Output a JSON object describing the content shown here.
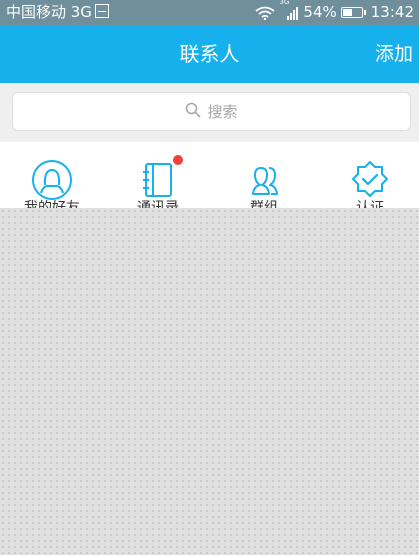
{
  "status_bar": {
    "carrier": "中国移动 3G",
    "network_3g": "3G",
    "battery_percent": "54%",
    "battery_level": 0.54,
    "time": "13:42"
  },
  "header": {
    "title": "联系人",
    "add_label": "添加"
  },
  "search": {
    "placeholder": "搜索"
  },
  "quick_actions": [
    {
      "icon": "person-avatar-icon",
      "label": "我的好友"
    },
    {
      "icon": "address-book-icon",
      "label": "通讯录",
      "has_badge": true
    },
    {
      "icon": "group-icon",
      "label": "群组"
    },
    {
      "icon": "verified-badge-icon",
      "label": "认证"
    }
  ],
  "colors": {
    "accent": "#16b1ec",
    "badge": "#ef4437",
    "status_bar": "#6f8f9c"
  }
}
